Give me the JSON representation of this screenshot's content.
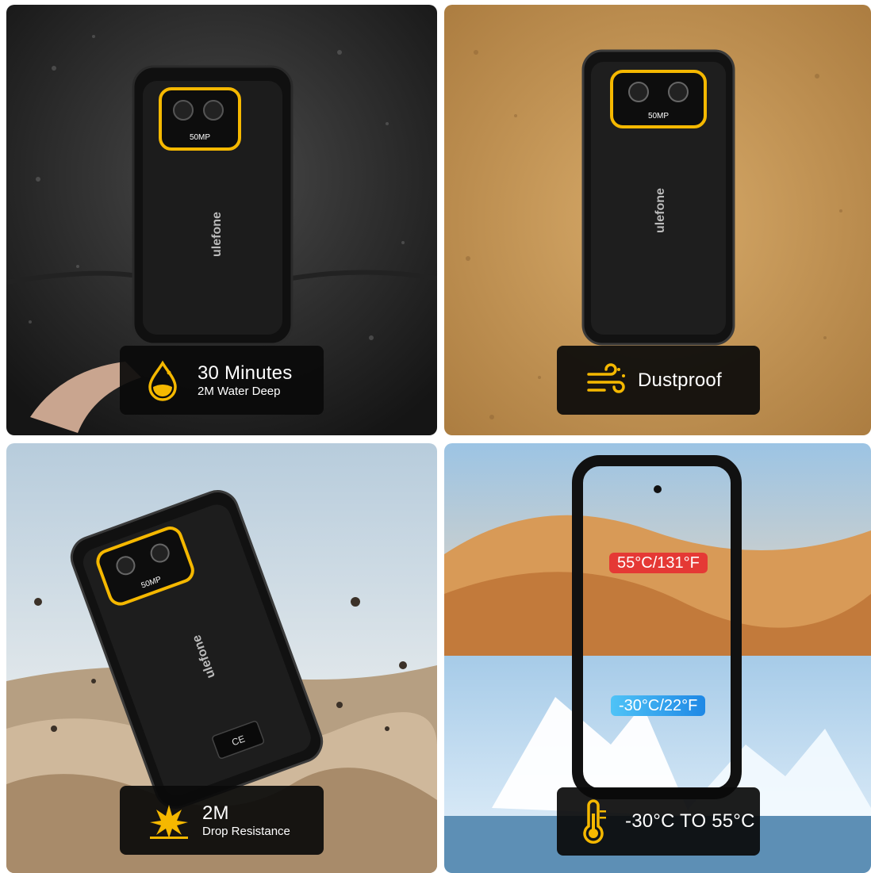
{
  "panels": {
    "water": {
      "badge_main": "30 Minutes",
      "badge_sub": "2M Water Deep",
      "icon": "water-drop-icon",
      "camera_label": "50MP",
      "brand": "ulefone"
    },
    "dust": {
      "badge_main": "Dustproof",
      "icon": "wind-dust-icon",
      "camera_label": "50MP",
      "brand": "ulefone"
    },
    "drop": {
      "badge_main": "2M",
      "badge_sub": "Drop Resistance",
      "icon": "impact-burst-icon",
      "camera_label": "50MP",
      "brand": "ulefone",
      "cert_mark": "CE"
    },
    "temperature": {
      "hot_label": "55°C/131°F",
      "cold_label": "-30°C/22°F",
      "badge_main": "-30°C TO 55°C",
      "icon": "thermometer-icon"
    }
  },
  "colors": {
    "accent": "#f5b800",
    "badge_bg": "#0a0a0a",
    "hot": "#e53935",
    "cold": "#1e88e5"
  }
}
